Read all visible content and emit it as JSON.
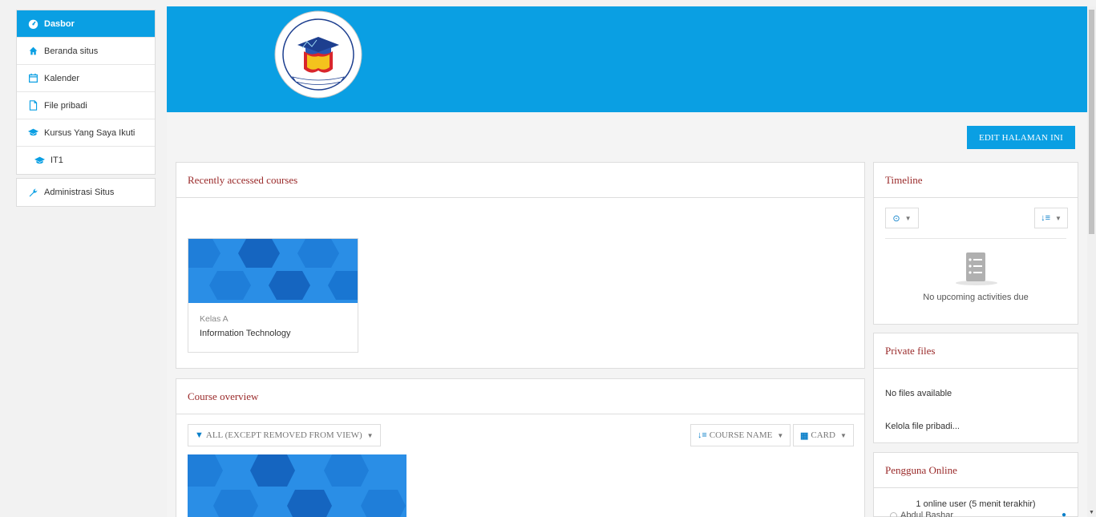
{
  "sidebar": {
    "items": [
      {
        "label": "Dasbor",
        "icon": "dashboard-icon"
      },
      {
        "label": "Beranda situs",
        "icon": "home-icon"
      },
      {
        "label": "Kalender",
        "icon": "calendar-icon"
      },
      {
        "label": "File pribadi",
        "icon": "file-icon"
      },
      {
        "label": "Kursus Yang Saya Ikuti",
        "icon": "graduation-cap-icon"
      },
      {
        "label": "IT1",
        "icon": "graduation-cap-icon"
      }
    ],
    "admin": {
      "label": "Administrasi Situs",
      "icon": "wrench-icon"
    }
  },
  "banner": {
    "logo_text_top": "SEKOLAH TINGGI ILMU KESEHATAN GUNUNG SARI",
    "logo_text_ribbon": "STIKES GUNUNG SARI",
    "logo_text_bottom": "MAKASSAR"
  },
  "edit_button": "EDIT HALAMAN INI",
  "recent": {
    "title": "Recently accessed courses",
    "course": {
      "category": "Kelas A",
      "name": "Information Technology"
    }
  },
  "overview": {
    "title": "Course overview",
    "filter": "ALL (EXCEPT REMOVED FROM VIEW)",
    "sort": "COURSE NAME",
    "view": "CARD"
  },
  "timeline": {
    "title": "Timeline",
    "empty": "No upcoming activities due"
  },
  "private_files": {
    "title": "Private files",
    "empty": "No files available",
    "manage_link": "Kelola file pribadi..."
  },
  "online_users": {
    "title": "Pengguna Online",
    "summary": "1 online user (5 menit terakhir)",
    "users": [
      "Abdul Bashar"
    ]
  },
  "colors": {
    "brand": "#0a9fe3",
    "heading": "#9a2a2a",
    "link": "#0a7fc9"
  }
}
